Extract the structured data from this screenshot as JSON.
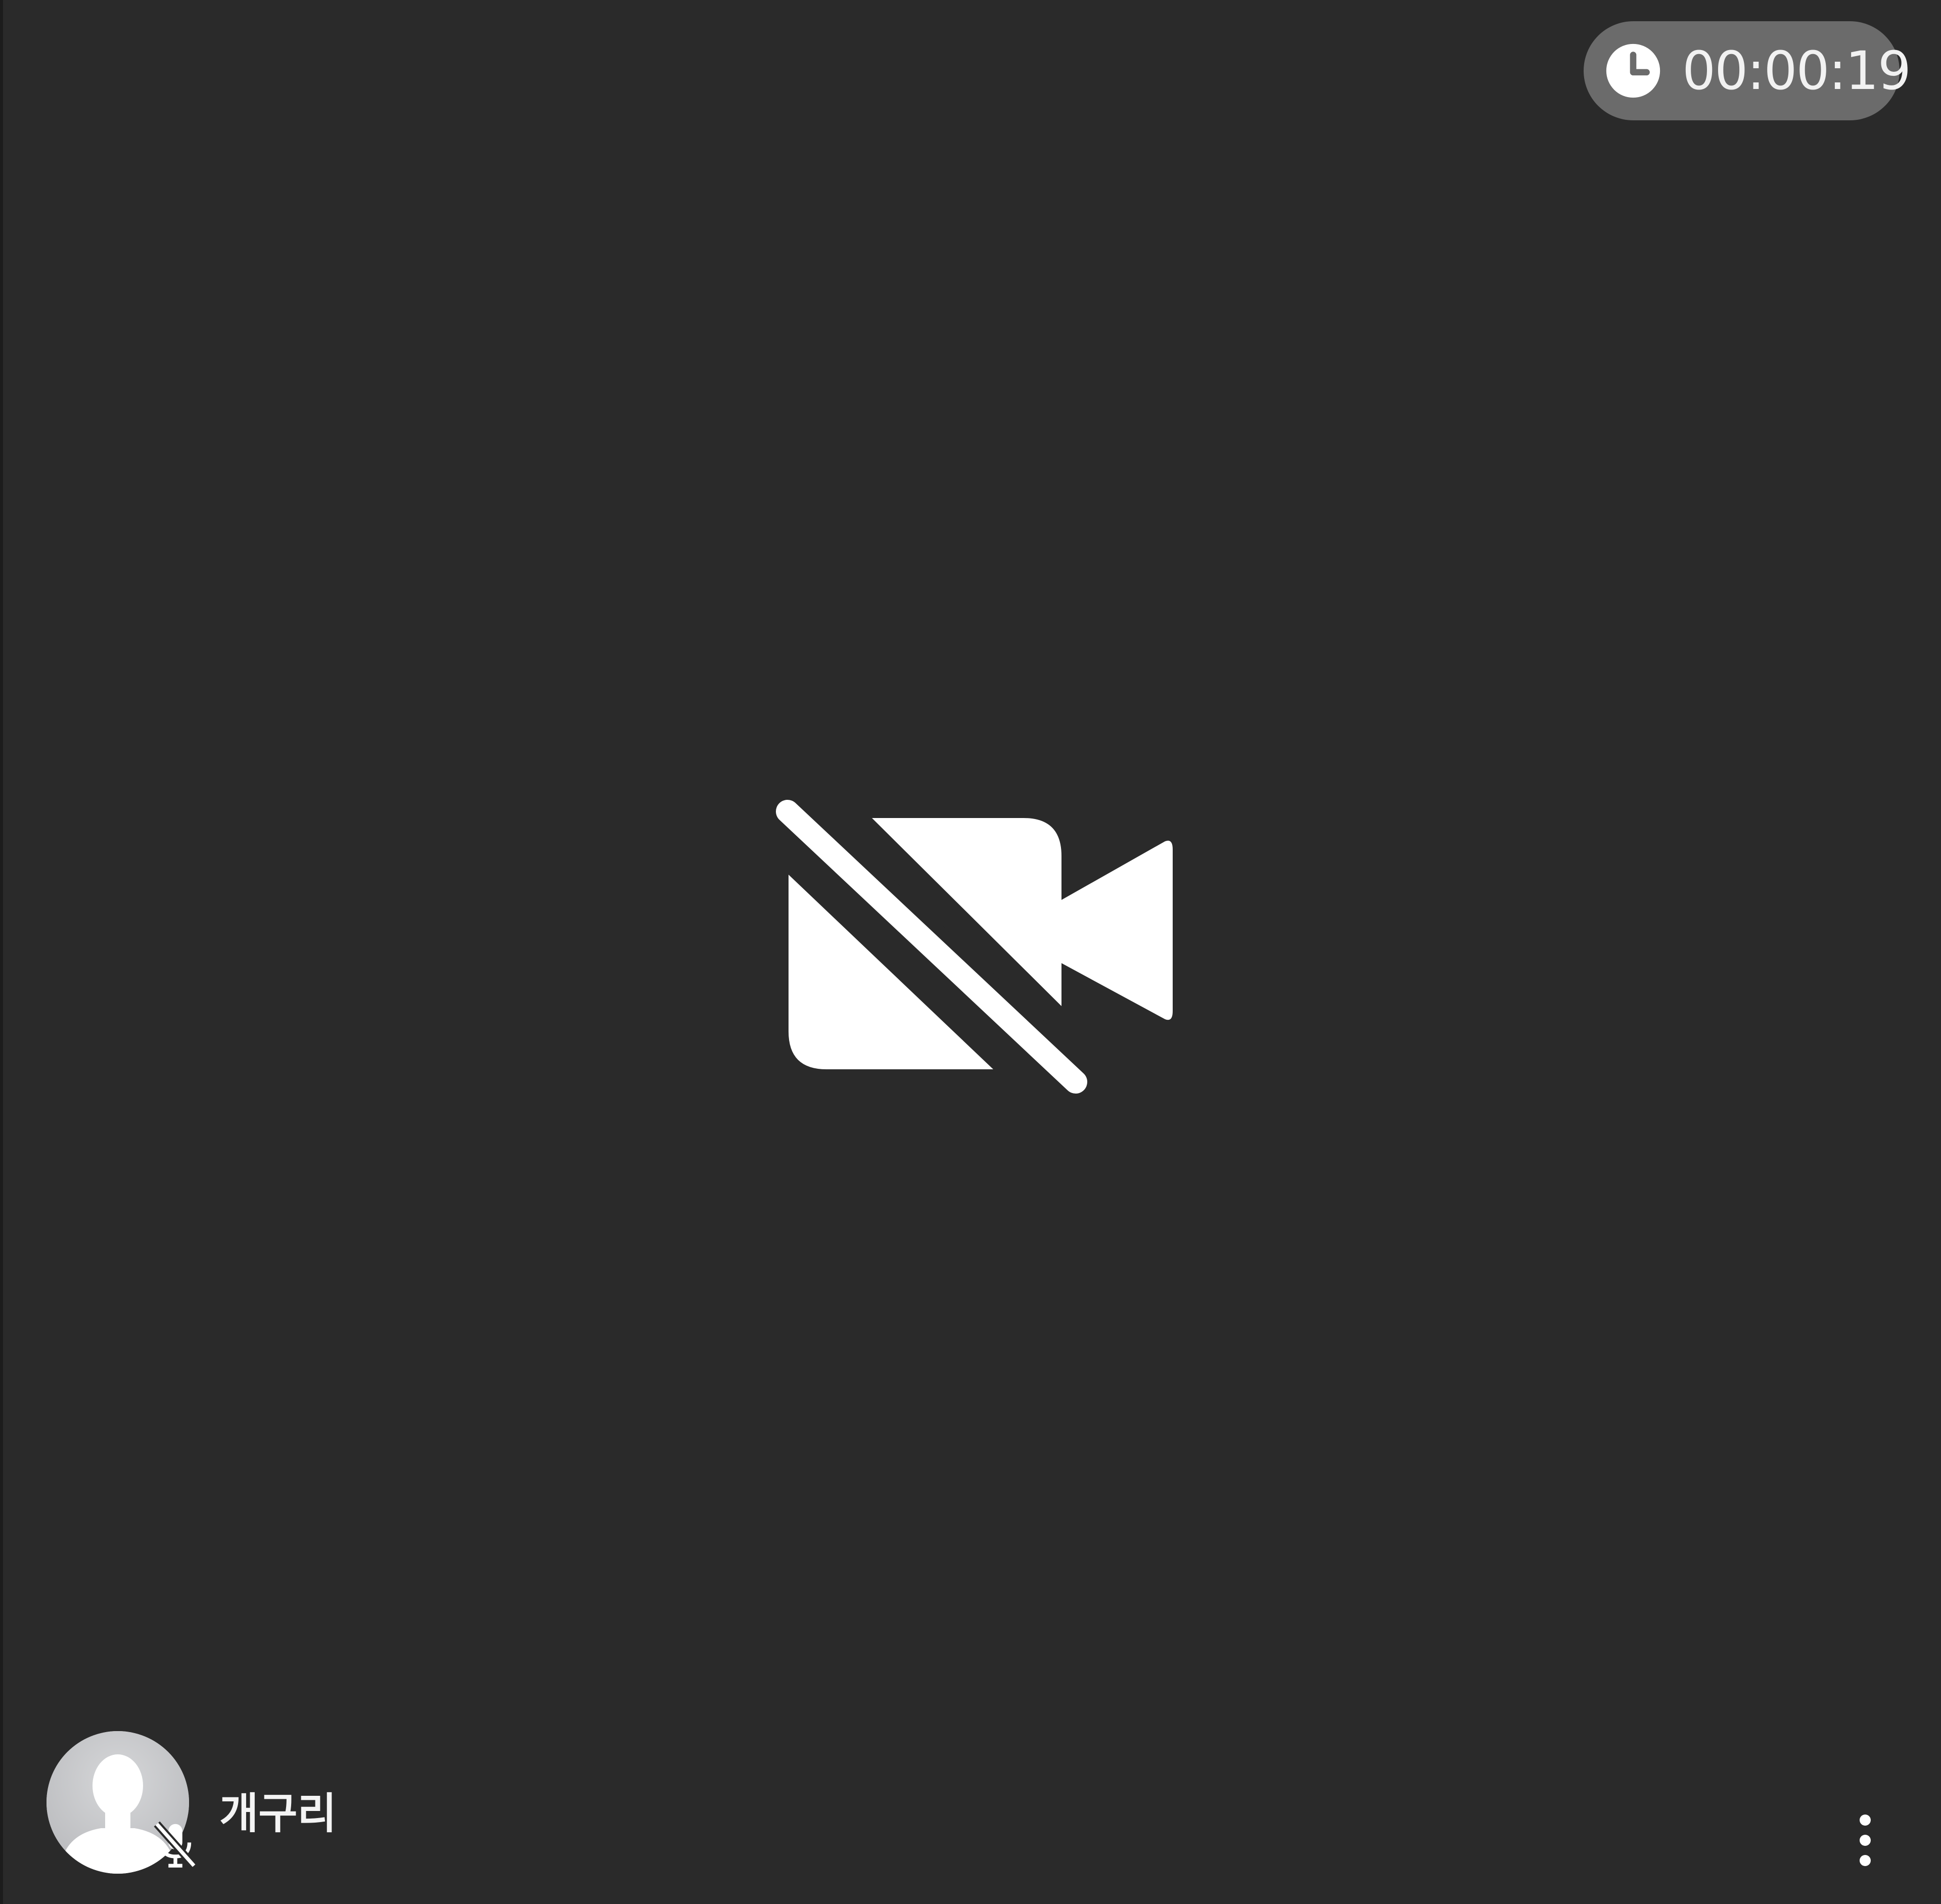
{
  "call": {
    "elapsed_time": "00:00:19",
    "camera_state": "video-camera-off-icon"
  },
  "participant": {
    "name": "개구리",
    "avatar_icon": "default-person-avatar",
    "mic_state": "mic-muted-icon"
  },
  "controls": {
    "more_icon": "more-vertical-icon"
  },
  "colors": {
    "background": "#2a2a2a",
    "timer_pill": "#6b6b6b",
    "icon": "#ffffff",
    "avatar_bg": "#c9cacc"
  }
}
